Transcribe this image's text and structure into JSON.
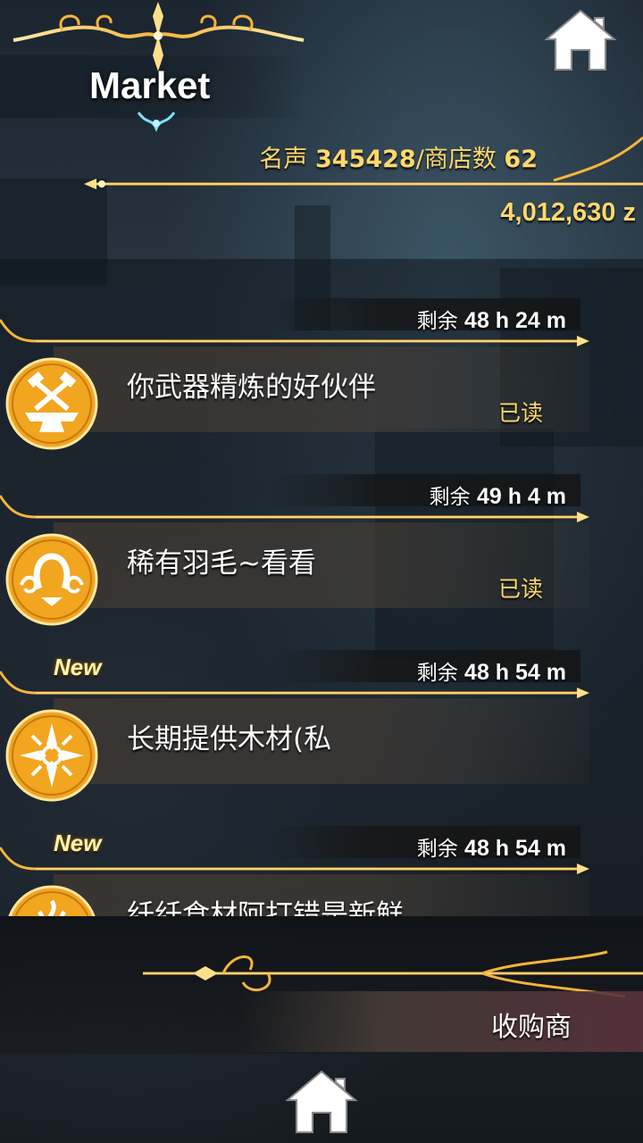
{
  "header": {
    "title": "Market",
    "reputation_label": "名声",
    "reputation_value": "345428",
    "shops_label": "/商店数",
    "shops_value": "62",
    "money": "4,012,630 z"
  },
  "colors": {
    "gold": "#ffd86b",
    "gold_line": "#f6b43a",
    "emblem_fill": "#f2a51f"
  },
  "offers": [
    {
      "time_label": "剩余",
      "time_value": "48 h 24 m",
      "title": "你武器精炼的好伙伴",
      "status": "已读",
      "new_badge": "",
      "icon": "anvil-hammer-icon"
    },
    {
      "time_label": "剩余",
      "time_value": "49 h 4 m",
      "title": "稀有羽毛~看看",
      "status": "已读",
      "new_badge": "",
      "icon": "horseshoe-swirl-icon"
    },
    {
      "time_label": "剩余",
      "time_value": "48 h 54 m",
      "title": "长期提供木材(私",
      "status": "",
      "new_badge": "New",
      "icon": "thorn-cross-icon"
    },
    {
      "time_label": "剩余",
      "time_value": "48 h 54 m",
      "title": "纤纤食材阿打错是新鲜",
      "status": "",
      "new_badge": "New",
      "icon": "flame-crest-icon"
    }
  ],
  "bottom": {
    "button_label": "收购商"
  }
}
